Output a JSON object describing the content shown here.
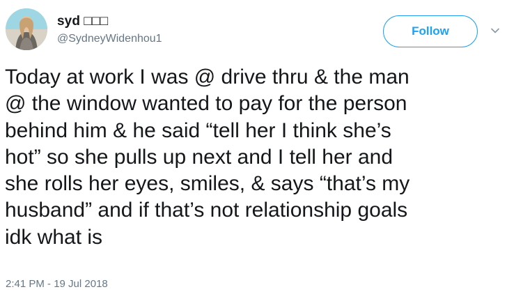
{
  "user": {
    "display_name": "syd □□□",
    "handle": "@SydneyWidenhou1"
  },
  "actions": {
    "follow_label": "Follow",
    "menu_icon": "chevron-down-icon"
  },
  "tweet": {
    "text": "Today at work I was @ drive thru & the man\n@ the window wanted to pay for the person\nbehind him & he said “tell her I think she’s\nhot” so she pulls up next and I tell her and\nshe rolls her eyes, smiles, & says “that’s my\nhusband” and if that’s not relationship goals\nidk what is",
    "timestamp": "2:41 PM - 19 Jul 2018"
  },
  "colors": {
    "accent": "#1da1f2",
    "text": "#14171a",
    "muted": "#657786"
  }
}
